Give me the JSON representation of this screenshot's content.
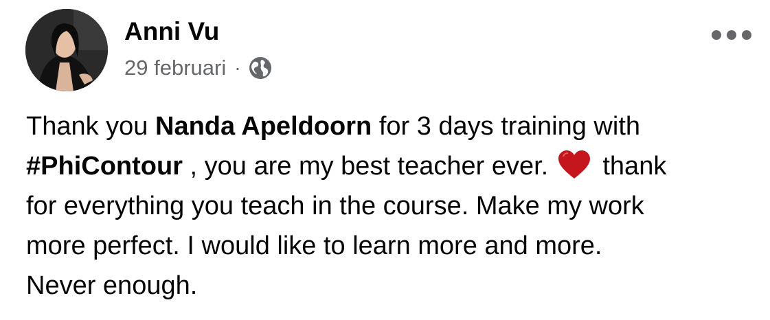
{
  "post": {
    "author": "Anni Vu",
    "date": "29 februari",
    "separator": "·",
    "privacy_icon": "globe-icon",
    "more_icon": "more-options-icon",
    "text": {
      "line1_a": "Thank you ",
      "mention": "Nanda Apeldoorn",
      "line1_b": " for 3 days training with",
      "hashtag": "#PhiContour",
      "line2_b": " , you are my best teacher ever. ",
      "emoji": "heart-emoji",
      "line2_c": " thank",
      "line3": "for everything you teach in the course. Make my work",
      "line4": "more perfect. I would like to learn more and more.",
      "line5": "Never enough."
    }
  }
}
